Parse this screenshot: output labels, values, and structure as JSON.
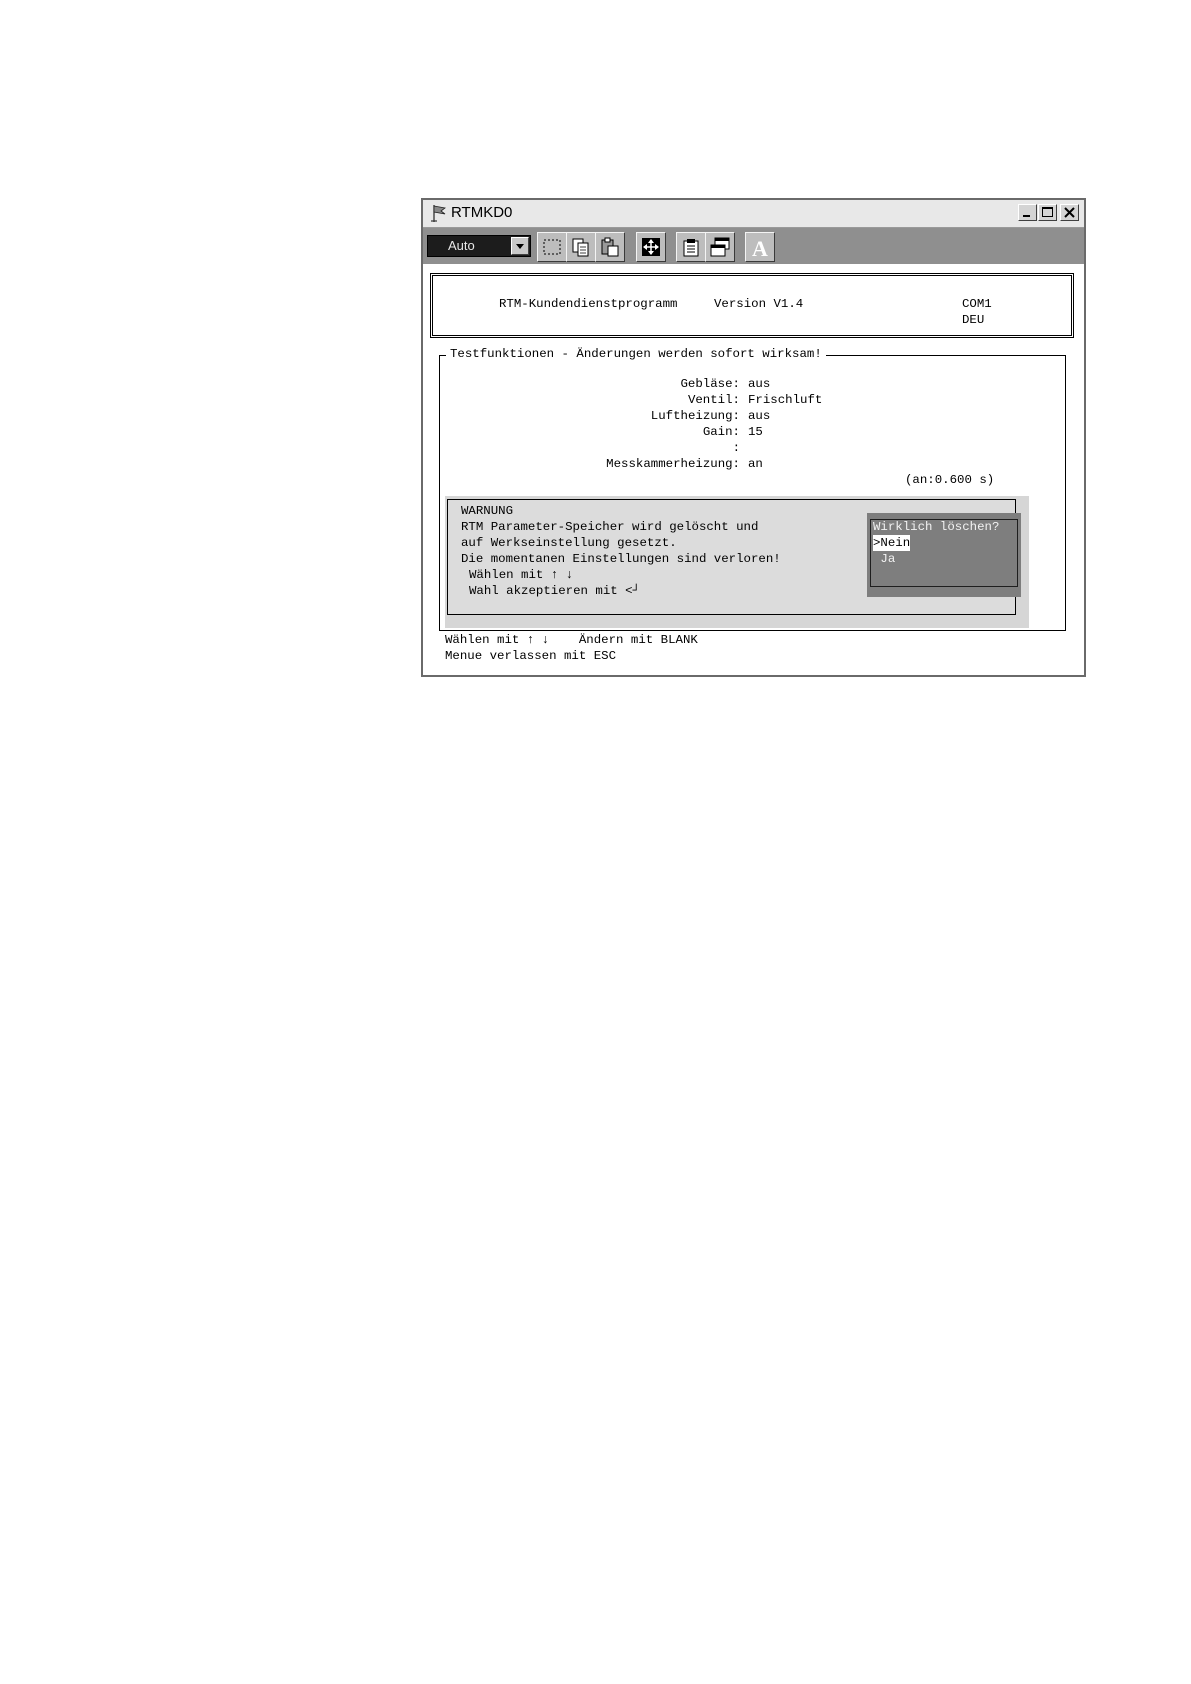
{
  "window": {
    "title": "RTMKD0",
    "buttons": [
      "minimize-icon",
      "maximize-icon",
      "close-icon"
    ]
  },
  "toolbar": {
    "font_combo": "Auto",
    "buttons": [
      "mark-icon",
      "copy-icon",
      "paste-icon",
      "fullscreen-icon",
      "properties-icon",
      "background-icon",
      "font-icon"
    ],
    "font_button_glyph": "A"
  },
  "header": {
    "program": "RTM-Kundendienstprogramm",
    "version": "Version V1.4",
    "port": "COM1",
    "language": "DEU"
  },
  "panel": {
    "title": "Testfunktionen - Änderungen werden sofort wirksam!",
    "fields": [
      {
        "label": "Gebläse:",
        "value": "aus"
      },
      {
        "label": "Ventil:",
        "value": "Frischluft"
      },
      {
        "label": "Luftheizung:",
        "value": "aus"
      },
      {
        "label": "Gain:",
        "value": "15"
      },
      {
        "label": ":",
        "value": ""
      },
      {
        "label": "Messkammerheizung:",
        "value": "an"
      }
    ],
    "timer": "(an:0.600 s)"
  },
  "warning": {
    "heading": "WARNUNG",
    "lines": [
      "RTM Parameter-Speicher wird gelöscht und",
      "auf Werkseinstellung gesetzt.",
      "Die momentanen Einstellungen sind verloren!"
    ],
    "hint_select": "Wählen mit ↑ ↓",
    "hint_accept": "Wahl akzeptieren mit <┘"
  },
  "dialog": {
    "question": "Wirklich löschen?",
    "options": [
      {
        "label": ">Nein",
        "selected": true
      },
      {
        "label": " Ja",
        "selected": false
      }
    ]
  },
  "footer": {
    "line1": "Wählen mit ↑ ↓    Ändern mit BLANK",
    "line2": "Menue verlassen mit ESC"
  }
}
